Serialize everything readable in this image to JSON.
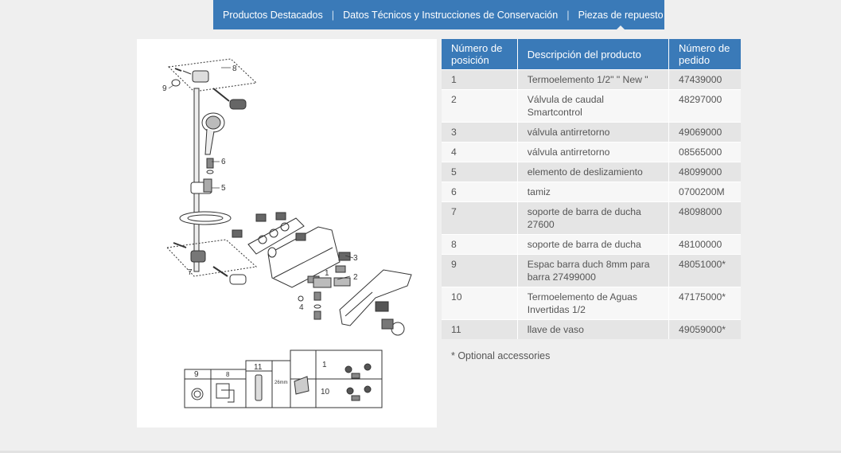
{
  "tabs": [
    {
      "label": "Productos Destacados"
    },
    {
      "label": "Datos Técnicos y Instrucciones de Conservación"
    },
    {
      "label": "Piezas de repuesto"
    }
  ],
  "diagram": {
    "callouts": [
      "8",
      "9",
      "6",
      "5",
      "7",
      "3",
      "2",
      "1",
      "4"
    ],
    "inset": {
      "n9": "9",
      "n8": "8",
      "n11": "11",
      "n26": "26mm",
      "n1": "1",
      "n10": "10"
    }
  },
  "table": {
    "headers": [
      "Número de posición",
      "Descripción del producto",
      "Número de pedido"
    ],
    "rows": [
      {
        "pos": "1",
        "desc": "Termoelemento 1/2\" \" New \"",
        "order": "47439000"
      },
      {
        "pos": "2",
        "desc": "Válvula de caudal Smartcontrol",
        "order": "48297000"
      },
      {
        "pos": "3",
        "desc": "válvula antirretorno",
        "order": "49069000"
      },
      {
        "pos": "4",
        "desc": "válvula antirretorno",
        "order": "08565000"
      },
      {
        "pos": "5",
        "desc": "elemento de deslizamiento",
        "order": "48099000"
      },
      {
        "pos": "6",
        "desc": "tamiz",
        "order": "0700200M"
      },
      {
        "pos": "7",
        "desc": "soporte de barra de ducha 27600",
        "order": "48098000"
      },
      {
        "pos": "8",
        "desc": "soporte de barra de ducha",
        "order": "48100000"
      },
      {
        "pos": "9",
        "desc": "Espac barra duch 8mm para barra 27499000",
        "order": "48051000*"
      },
      {
        "pos": "10",
        "desc": "Termoelemento de Aguas Invertidas 1/2",
        "order": "47175000*"
      },
      {
        "pos": "11",
        "desc": "llave de vaso",
        "order": "49059000*"
      }
    ]
  },
  "note": "* Optional accessories",
  "colors": {
    "accent": "#3a7ab8",
    "background": "#efefef"
  }
}
